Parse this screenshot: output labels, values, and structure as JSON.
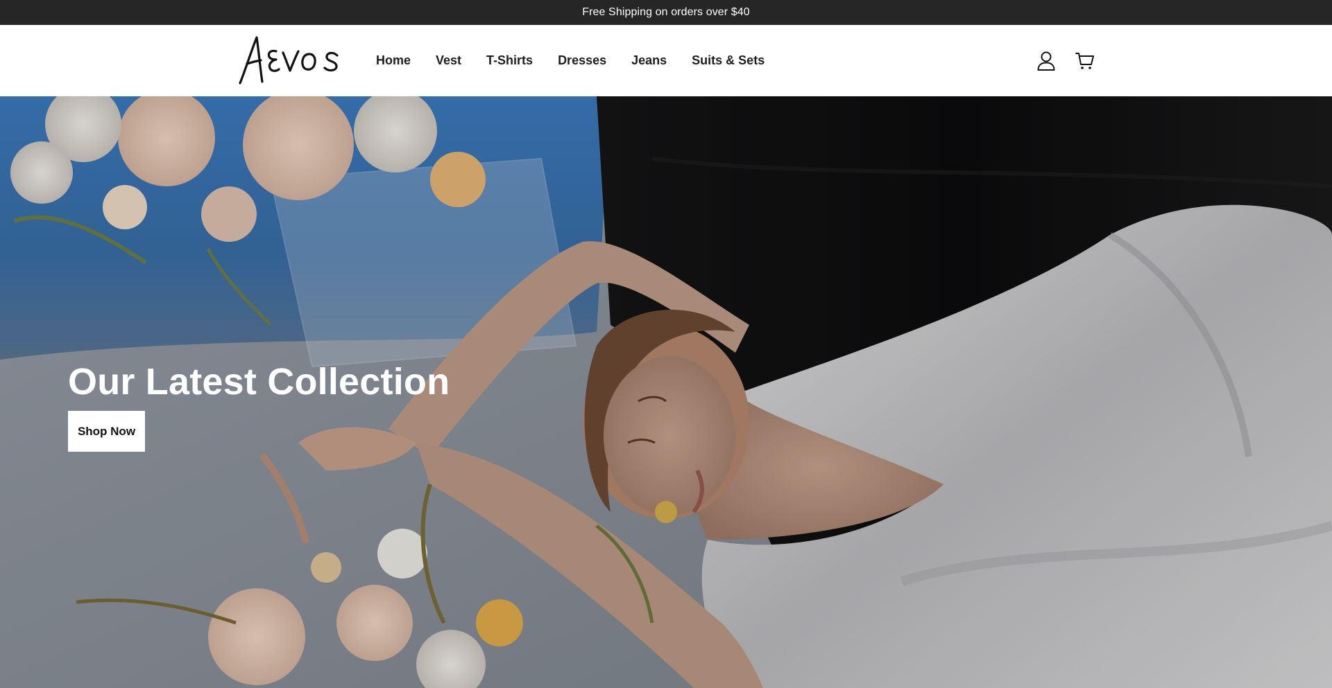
{
  "announcement": {
    "text": "Free Shipping on orders over $40"
  },
  "header": {
    "logo_text": "AEVOS",
    "nav": [
      {
        "label": "Home"
      },
      {
        "label": "Vest"
      },
      {
        "label": "T-Shirts"
      },
      {
        "label": "Dresses"
      },
      {
        "label": "Jeans"
      },
      {
        "label": "Suits & Sets"
      }
    ],
    "icons": [
      "account-icon",
      "cart-icon"
    ]
  },
  "hero": {
    "title": "Our Latest Collection",
    "button_label": "Shop Now",
    "image": "woman-in-white-satin-dress-with-flowers"
  },
  "colors": {
    "announcement_bg": "#262626",
    "header_bg": "#ffffff",
    "text": "#121212",
    "button_bg": "#ffffff"
  }
}
